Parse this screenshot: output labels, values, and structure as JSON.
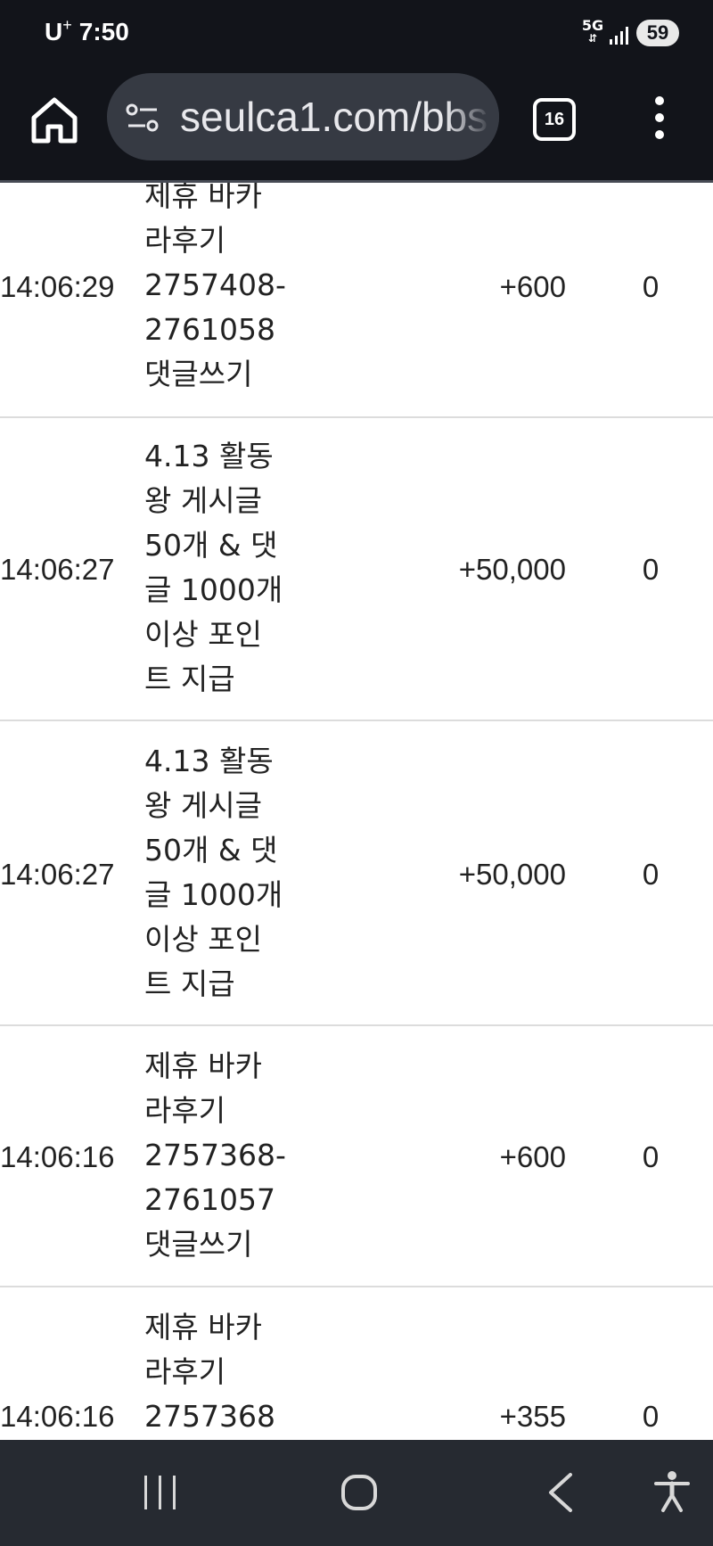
{
  "status_bar": {
    "carrier": "U",
    "carrier_sup": "+",
    "time": "7:50",
    "network": "5G",
    "battery": "59"
  },
  "browser": {
    "url": "seulca1.com/bbs",
    "tab_count": "16"
  },
  "rows": [
    {
      "time": "14:06:29",
      "content_lines": [
        "제휴 바카",
        "라후기",
        "2757408-",
        "2761058",
        "댓글쓰기"
      ],
      "point": "+600",
      "balance": "0"
    },
    {
      "time": "14:06:27",
      "content_lines": [
        "4.13 활동",
        "왕 게시글",
        "50개 & 댓",
        "글 1000개",
        "이상 포인",
        "트 지급"
      ],
      "point": "+50,000",
      "balance": "0"
    },
    {
      "time": "14:06:27",
      "content_lines": [
        "4.13 활동",
        "왕 게시글",
        "50개 & 댓",
        "글 1000개",
        "이상 포인",
        "트 지급"
      ],
      "point": "+50,000",
      "balance": "0"
    },
    {
      "time": "14:06:16",
      "content_lines": [
        "제휴 바카",
        "라후기",
        "2757368-",
        "2761057",
        "댓글쓰기"
      ],
      "point": "+600",
      "balance": "0"
    },
    {
      "time": "14:06:16",
      "content_lines": [
        "제휴 바카",
        "라후기",
        "2757368"
      ],
      "point": "+355",
      "balance": "0"
    }
  ]
}
